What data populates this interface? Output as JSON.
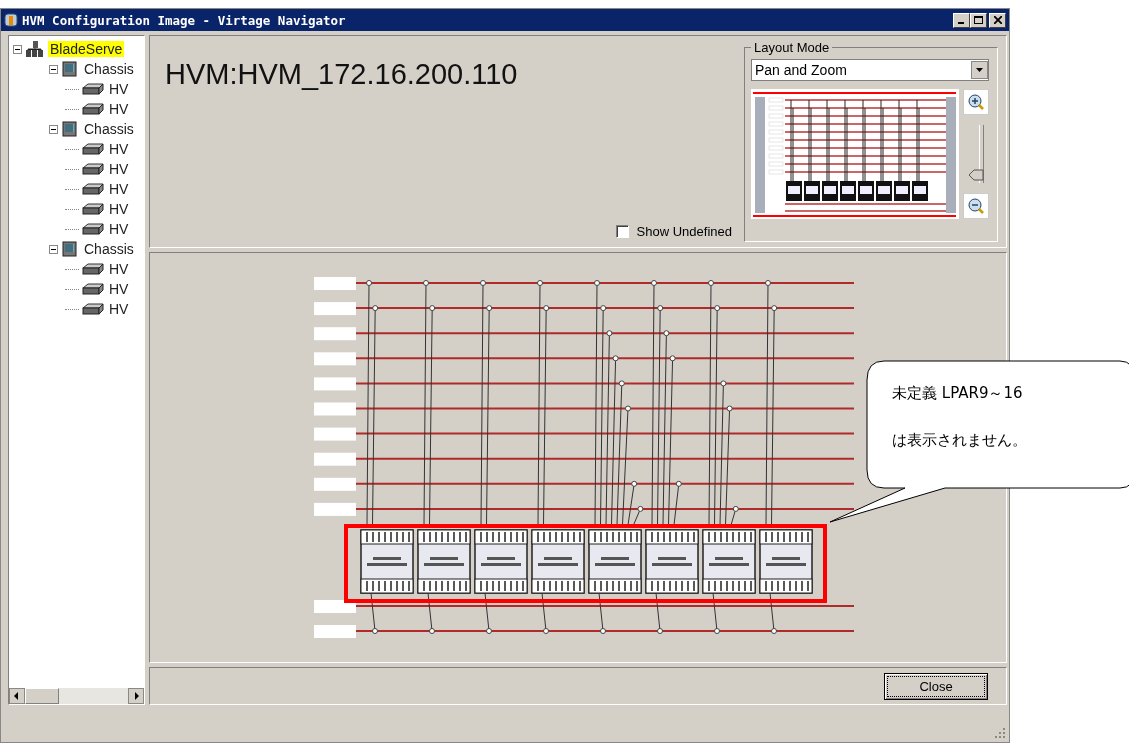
{
  "window": {
    "title": "HVM Configuration Image - Virtage Navigator"
  },
  "tree": [
    {
      "label": "BladeServe",
      "selected": true,
      "expanded": true,
      "children": [
        {
          "label": "Chassis",
          "selected": false,
          "expanded": true,
          "children": [
            {
              "label": "HV",
              "selected": false
            },
            {
              "label": "HV",
              "selected": false
            }
          ]
        },
        {
          "label": "Chassis",
          "selected": false,
          "expanded": true,
          "children": [
            {
              "label": "HV",
              "selected": false
            },
            {
              "label": "HV",
              "selected": false
            },
            {
              "label": "HV",
              "selected": false
            },
            {
              "label": "HV",
              "selected": false
            },
            {
              "label": "HV",
              "selected": false
            }
          ]
        },
        {
          "label": "Chassis",
          "selected": false,
          "expanded": true,
          "children": [
            {
              "label": "HV",
              "selected": false
            },
            {
              "label": "HV",
              "selected": false
            },
            {
              "label": "HV",
              "selected": false
            }
          ]
        }
      ]
    }
  ],
  "heading": "HVM:HVM_172.16.200.110",
  "show_undefined": {
    "label": "Show Undefined",
    "checked": false
  },
  "layout_mode": {
    "legend": "Layout Mode",
    "value": "Pan and Zoom",
    "zoom_slider": {
      "level": 0.05
    }
  },
  "callout": [
    "未定義 LPAR9～16",
    "は表示されません。"
  ],
  "buttons": [
    "Close"
  ]
}
